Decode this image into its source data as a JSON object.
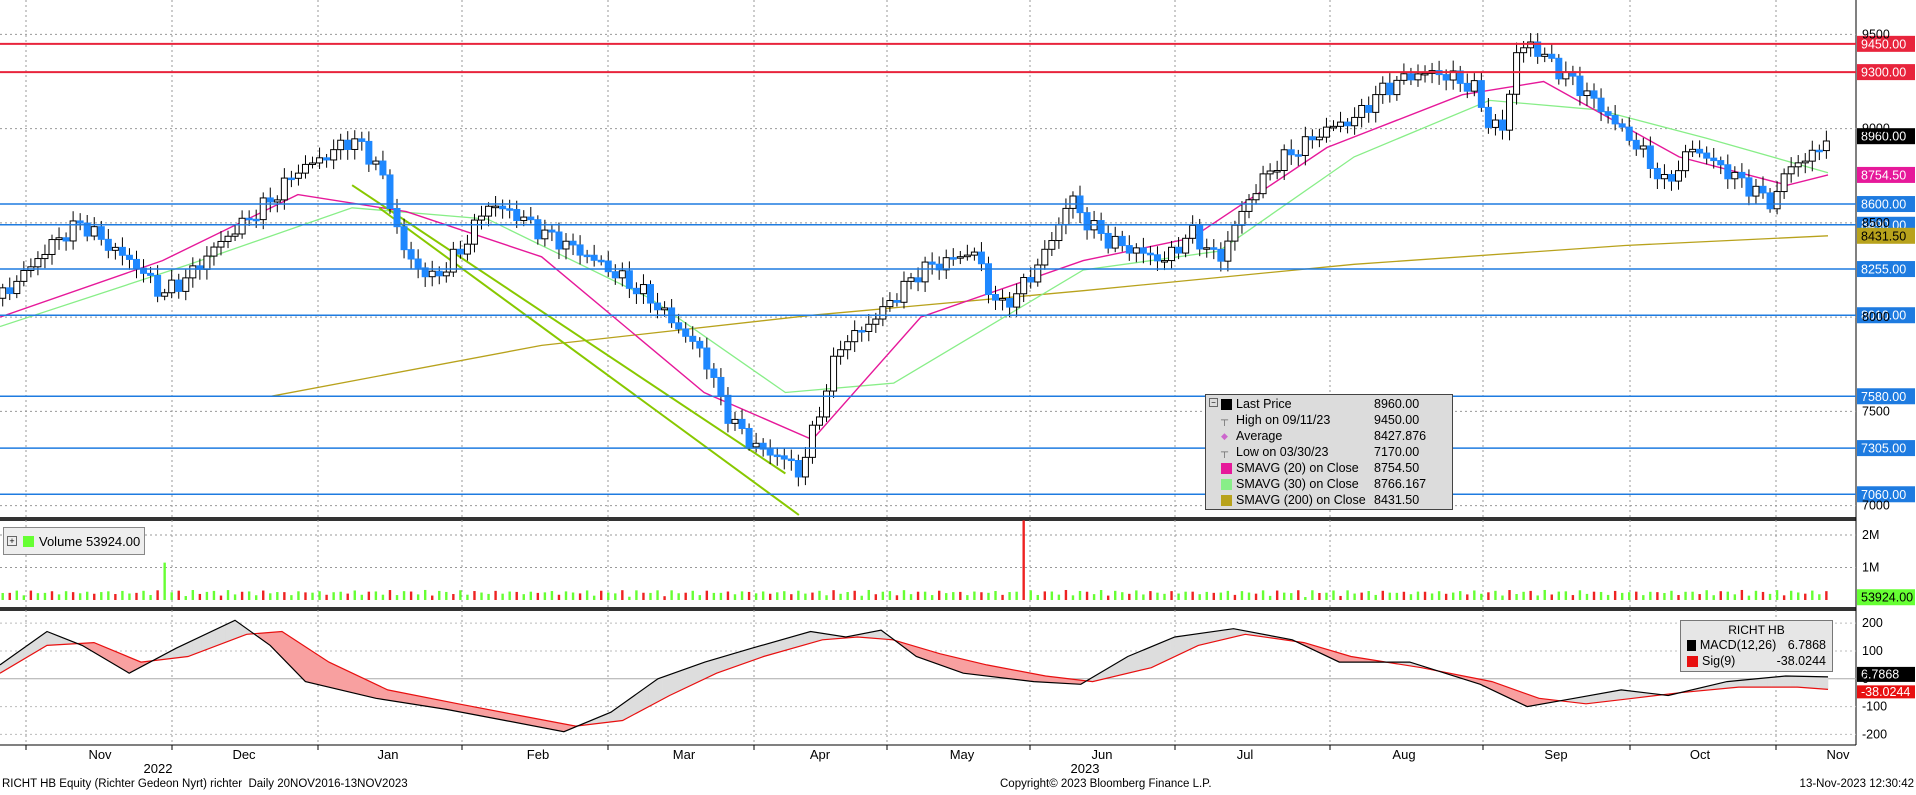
{
  "chart_data": {
    "type": "candlestick",
    "security": "RICHT HB Equity (Richter Gedeon Nyrt) richter",
    "period": "Daily 20NOV2016-13NOV2023",
    "copyright": "Copyright© 2023 Bloomberg Finance L.P.",
    "timestamp": "13-Nov-2023 12:30:42",
    "x_ticks": [
      "Nov",
      "Dec",
      "Jan",
      "Feb",
      "Mar",
      "Apr",
      "May",
      "Jun",
      "Jul",
      "Aug",
      "Sep",
      "Oct",
      "Nov"
    ],
    "year_labels": [
      "2022",
      "2023"
    ],
    "price_axis": {
      "ylim": [
        6950,
        9550
      ],
      "ticks": [
        7000,
        7500,
        8000,
        8500,
        9000,
        9500
      ],
      "tick_labels": [
        "7000",
        "7500",
        "8000",
        "8500",
        "9000",
        "9500"
      ]
    },
    "price_levels": [
      {
        "label": "9450.00",
        "value": 9450,
        "color": "#e8243c"
      },
      {
        "label": "9300.00",
        "value": 9300,
        "color": "#e8243c"
      },
      {
        "label": "8960.00",
        "value": 8960,
        "color": "#000000"
      },
      {
        "label": "8754.50",
        "value": 8754.5,
        "color": "#e6199a"
      },
      {
        "label": "8600.00",
        "value": 8600,
        "color": "#1e7be0"
      },
      {
        "label": "8490.00",
        "value": 8490,
        "color": "#1e7be0"
      },
      {
        "label": "8431.50",
        "value": 8431.5,
        "color": "#b8a21c"
      },
      {
        "label": "8255.00",
        "value": 8255,
        "color": "#1e7be0"
      },
      {
        "label": "8010.00",
        "value": 8010,
        "color": "#1e7be0"
      },
      {
        "label": "7580.00",
        "value": 7580,
        "color": "#1e7be0"
      },
      {
        "label": "7305.00",
        "value": 7305,
        "color": "#1e7be0"
      },
      {
        "label": "7060.00",
        "value": 7060,
        "color": "#1e7be0"
      }
    ],
    "series": [
      {
        "name": "Last Price",
        "value": "8960.00",
        "color": "#000000"
      },
      {
        "name": "High on 09/11/23",
        "value": "9450.00",
        "color": "#888888"
      },
      {
        "name": "Average",
        "value": "8427.876",
        "color": "#cc66cc"
      },
      {
        "name": "Low on 03/30/23",
        "value": "7170.00",
        "color": "#888888"
      },
      {
        "name": "SMAVG (20)  on Close",
        "value": "8754.50",
        "color": "#e6199a"
      },
      {
        "name": "SMAVG (30)  on Close",
        "value": "8766.167",
        "color": "#88ee88"
      },
      {
        "name": "SMAVG (200)  on Close",
        "value": "8431.50",
        "color": "#b8a21c"
      }
    ],
    "price_points": [
      [
        0,
        8100
      ],
      [
        10,
        8250
      ],
      [
        20,
        8400
      ],
      [
        30,
        8500
      ],
      [
        40,
        8380
      ],
      [
        50,
        8280
      ],
      [
        60,
        8120
      ],
      [
        70,
        8220
      ],
      [
        80,
        8380
      ],
      [
        90,
        8500
      ],
      [
        100,
        8620
      ],
      [
        110,
        8780
      ],
      [
        120,
        8850
      ],
      [
        130,
        8950
      ],
      [
        140,
        8800
      ],
      [
        145,
        8550
      ],
      [
        150,
        8320
      ],
      [
        160,
        8200
      ],
      [
        170,
        8350
      ],
      [
        180,
        8600
      ],
      [
        190,
        8550
      ],
      [
        200,
        8450
      ],
      [
        210,
        8380
      ],
      [
        220,
        8300
      ],
      [
        230,
        8200
      ],
      [
        240,
        8100
      ],
      [
        250,
        7950
      ],
      [
        260,
        7800
      ],
      [
        265,
        7600
      ],
      [
        270,
        7450
      ],
      [
        280,
        7300
      ],
      [
        290,
        7250
      ],
      [
        295,
        7170
      ],
      [
        300,
        7380
      ],
      [
        310,
        7850
      ],
      [
        320,
        7950
      ],
      [
        330,
        8100
      ],
      [
        340,
        8250
      ],
      [
        350,
        8300
      ],
      [
        360,
        8350
      ],
      [
        365,
        8150
      ],
      [
        370,
        8050
      ],
      [
        380,
        8200
      ],
      [
        390,
        8450
      ],
      [
        395,
        8650
      ],
      [
        400,
        8520
      ],
      [
        410,
        8400
      ],
      [
        420,
        8350
      ],
      [
        430,
        8300
      ],
      [
        440,
        8450
      ],
      [
        450,
        8300
      ],
      [
        460,
        8600
      ],
      [
        470,
        8800
      ],
      [
        480,
        8900
      ],
      [
        490,
        9000
      ],
      [
        500,
        9050
      ],
      [
        510,
        9200
      ],
      [
        520,
        9280
      ],
      [
        530,
        9300
      ],
      [
        540,
        9250
      ],
      [
        545,
        9200
      ],
      [
        550,
        9020
      ],
      [
        555,
        9000
      ],
      [
        560,
        9400
      ],
      [
        565,
        9450
      ],
      [
        575,
        9320
      ],
      [
        585,
        9200
      ],
      [
        595,
        9050
      ],
      [
        605,
        8900
      ],
      [
        615,
        8700
      ],
      [
        625,
        8900
      ],
      [
        635,
        8800
      ],
      [
        645,
        8700
      ],
      [
        655,
        8600
      ],
      [
        660,
        8800
      ],
      [
        668,
        8840
      ],
      [
        675,
        8960
      ]
    ],
    "sma200_points": [
      [
        0,
        7580
      ],
      [
        100,
        7580
      ],
      [
        200,
        7850
      ],
      [
        300,
        8010
      ],
      [
        400,
        8140
      ],
      [
        500,
        8280
      ],
      [
        600,
        8380
      ],
      [
        675,
        8431.5
      ]
    ],
    "sma20_points": [
      [
        0,
        8000
      ],
      [
        60,
        8300
      ],
      [
        110,
        8650
      ],
      [
        150,
        8560
      ],
      [
        200,
        8320
      ],
      [
        260,
        7600
      ],
      [
        300,
        7350
      ],
      [
        340,
        8000
      ],
      [
        400,
        8300
      ],
      [
        440,
        8420
      ],
      [
        490,
        8900
      ],
      [
        540,
        9180
      ],
      [
        570,
        9250
      ],
      [
        620,
        8850
      ],
      [
        660,
        8700
      ],
      [
        675,
        8754.5
      ]
    ],
    "sma30_points": [
      [
        0,
        7950
      ],
      [
        70,
        8280
      ],
      [
        130,
        8580
      ],
      [
        180,
        8520
      ],
      [
        240,
        8100
      ],
      [
        290,
        7600
      ],
      [
        330,
        7650
      ],
      [
        400,
        8250
      ],
      [
        450,
        8350
      ],
      [
        500,
        8850
      ],
      [
        550,
        9150
      ],
      [
        590,
        9100
      ],
      [
        630,
        8950
      ],
      [
        675,
        8766
      ]
    ],
    "channel_lines": [
      {
        "color": "#88c800",
        "points": [
          [
            130,
            8700
          ],
          [
            290,
            7170
          ]
        ]
      },
      {
        "color": "#88c800",
        "points": [
          [
            140,
            8580
          ],
          [
            295,
            6950
          ]
        ]
      }
    ],
    "volume": {
      "label": "Volume",
      "last": "53924.00",
      "ticks": [
        "1M",
        "2M"
      ],
      "tick_values": [
        1000000,
        2000000
      ],
      "ylim": [
        0,
        2400000
      ],
      "spikes": [
        [
          60,
          1150000
        ],
        [
          378,
          2450000
        ]
      ]
    },
    "macd": {
      "title": "RICHT HB",
      "legend": [
        {
          "name": "MACD(12,26)",
          "value": "6.7868",
          "color": "#000000"
        },
        {
          "name": "Sig(9)",
          "value": "-38.0244",
          "color": "#e81010"
        }
      ],
      "ticks": [
        -200,
        -100,
        0,
        100,
        200
      ],
      "tick_labels": [
        "-200",
        "-100",
        "0",
        "100",
        "200"
      ],
      "ylim": [
        -220,
        240
      ],
      "macd_points": [
        [
          0,
          50
        ],
        [
          20,
          170
        ],
        [
          35,
          120
        ],
        [
          55,
          20
        ],
        [
          75,
          110
        ],
        [
          100,
          210
        ],
        [
          115,
          120
        ],
        [
          130,
          -10
        ],
        [
          160,
          -70
        ],
        [
          190,
          -110
        ],
        [
          215,
          -150
        ],
        [
          240,
          -190
        ],
        [
          260,
          -120
        ],
        [
          280,
          0
        ],
        [
          300,
          60
        ],
        [
          320,
          110
        ],
        [
          345,
          170
        ],
        [
          360,
          150
        ],
        [
          375,
          175
        ],
        [
          390,
          80
        ],
        [
          410,
          20
        ],
        [
          440,
          -10
        ],
        [
          460,
          -20
        ],
        [
          480,
          80
        ],
        [
          500,
          150
        ],
        [
          525,
          180
        ],
        [
          550,
          140
        ],
        [
          570,
          60
        ],
        [
          600,
          60
        ],
        [
          630,
          -20
        ],
        [
          650,
          -100
        ],
        [
          670,
          -70
        ],
        [
          690,
          -40
        ],
        [
          710,
          -60
        ],
        [
          735,
          -10
        ],
        [
          760,
          10
        ],
        [
          778,
          6.79
        ]
      ],
      "signal_points": [
        [
          0,
          20
        ],
        [
          20,
          120
        ],
        [
          40,
          130
        ],
        [
          60,
          60
        ],
        [
          80,
          80
        ],
        [
          105,
          160
        ],
        [
          120,
          170
        ],
        [
          140,
          60
        ],
        [
          165,
          -40
        ],
        [
          195,
          -90
        ],
        [
          220,
          -130
        ],
        [
          245,
          -170
        ],
        [
          265,
          -150
        ],
        [
          285,
          -60
        ],
        [
          305,
          20
        ],
        [
          325,
          80
        ],
        [
          350,
          140
        ],
        [
          365,
          150
        ],
        [
          380,
          140
        ],
        [
          400,
          90
        ],
        [
          420,
          50
        ],
        [
          445,
          10
        ],
        [
          465,
          -10
        ],
        [
          490,
          40
        ],
        [
          510,
          120
        ],
        [
          530,
          160
        ],
        [
          555,
          130
        ],
        [
          575,
          80
        ],
        [
          605,
          40
        ],
        [
          635,
          -10
        ],
        [
          655,
          -70
        ],
        [
          675,
          -90
        ],
        [
          695,
          -70
        ],
        [
          715,
          -50
        ],
        [
          740,
          -30
        ],
        [
          765,
          -30
        ],
        [
          778,
          -38.02
        ]
      ],
      "markers": [
        {
          "label": "6.7868",
          "value": 6.7868
        },
        {
          "label": "-38.0244",
          "value": -38.0244
        }
      ]
    }
  }
}
